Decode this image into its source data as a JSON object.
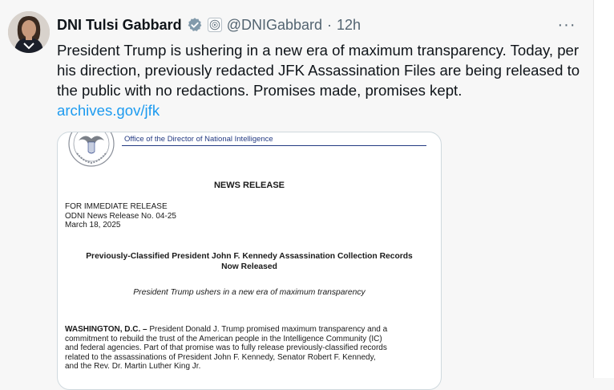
{
  "tweet": {
    "author_name": "DNI Tulsi Gabbard",
    "handle": "@DNIGabbard",
    "separator": "·",
    "time": "12h",
    "more_label": "···",
    "text": "President Trump is ushering in a new era of maximum transparency. Today, per his direction, previously redacted JFK Assassination Files are being released to the public with no redactions. Promises made, promises kept.",
    "link": "archives.gov/jfk",
    "colors": {
      "link": "#1d9bf0",
      "verified": "#829aab",
      "text": "#0f1419",
      "muted": "#536471"
    }
  },
  "document": {
    "office": "Office of the Director of National Intelligence",
    "news_release": "NEWS RELEASE",
    "release_lines": [
      "FOR IMMEDIATE RELEASE",
      "ODNI News Release No. 04-25",
      "March 18, 2025"
    ],
    "headline_line1": "Previously-Classified President John F. Kennedy Assassination Collection Records",
    "headline_line2": "Now Released",
    "subhead": "President Trump ushers in a new era of maximum transparency",
    "dateline": "WASHINGTON, D.C. –",
    "body_first": " President Donald J. Trump promised maximum transparency and a",
    "body_lines": [
      "commitment to rebuild the trust of the American people in the Intelligence Community (IC)",
      "and federal agencies. Part of that promise was to fully release previously-classified records",
      "related to the assassinations of President John F. Kennedy, Senator Robert F. Kennedy,",
      "and the Rev. Dr. Martin Luther King Jr."
    ]
  }
}
